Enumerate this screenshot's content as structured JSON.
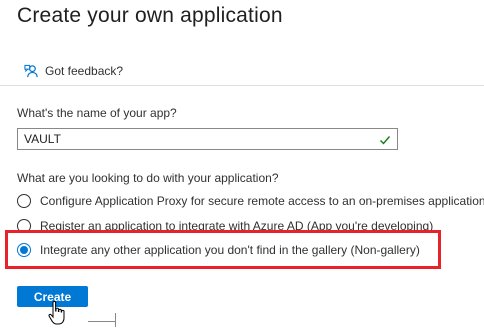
{
  "page": {
    "title": "Create your own application"
  },
  "feedback": {
    "label": "Got feedback?",
    "icon": "feedback-icon"
  },
  "app_name": {
    "question": "What's the name of your app?",
    "value": "VAULT",
    "valid_icon": "check-icon",
    "valid_color": "#107c10"
  },
  "purpose": {
    "question": "What are you looking to do with your application?",
    "options": [
      {
        "label": "Configure Application Proxy for secure remote access to an on-premises application",
        "selected": false
      },
      {
        "label": "Register an application to integrate with Azure AD (App you're developing)",
        "selected": false
      },
      {
        "label": "Integrate any other application you don't find in the gallery (Non-gallery)",
        "selected": true
      }
    ]
  },
  "actions": {
    "create_label": "Create"
  },
  "colors": {
    "accent": "#0078d4",
    "highlight": "#e8222b"
  }
}
